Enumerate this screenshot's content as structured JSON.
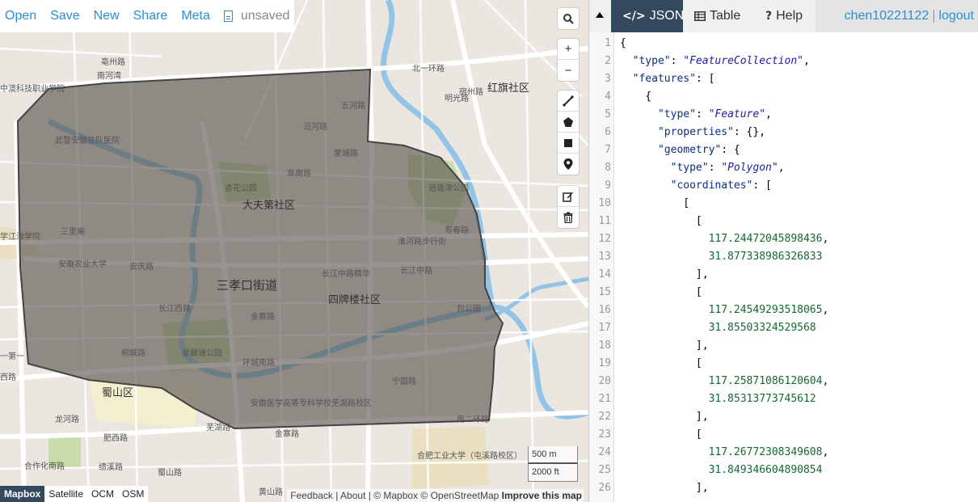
{
  "menu": {
    "open": "Open",
    "save": "Save",
    "new": "New",
    "share": "Share",
    "meta": "Meta",
    "file_status": "unsaved"
  },
  "map": {
    "labels": {
      "l1": "三孝口街道",
      "l2": "四牌楼社区",
      "l3": "大夫第社区",
      "l4": "红旗社区",
      "l5": "蜀山区",
      "l6": "安徽农业大学",
      "l7": "武警安徽总队医院",
      "l8": "中澳科技职业学院",
      "l9": "逍遥津公园",
      "l10": "包公园",
      "l11": "杏花公园",
      "l12": "皇藏塘公园",
      "l13": "合肥工业大学（屯溪路校区）",
      "l14": "安徽医学高等专科学校芜湖路校区",
      "l15": "长江中路",
      "l16": "长江西路",
      "l17": "环城南路",
      "l18": "芜湖路",
      "l19": "安庆路",
      "l20": "沿河路",
      "l21": "南河湾",
      "l22": "北一环路",
      "l23": "明光路",
      "l24": "蒙城路",
      "l25": "金寨路",
      "l26": "绩溪路",
      "l27": "龙河路",
      "l28": "黄山路",
      "l29": "宿州路",
      "l30": "淮河路步行街",
      "l31": "宁国路",
      "l32": "五河路",
      "l33": "寿春路",
      "l34": "阜南路",
      "l35": "亳州路",
      "l36": "长江中路精华",
      "l37": "三里庵",
      "l38": "学江淮学院",
      "l39": "一第一",
      "l40": "西路",
      "l41": "合作化南路",
      "l42": "肥西路",
      "l43": "南二环路",
      "l44": "桐城路",
      "l45": "金寨路",
      "l46": "蜀山路"
    }
  },
  "controls": {
    "search_icon": "search-icon",
    "zoom_in": "+",
    "zoom_out": "−"
  },
  "layers": [
    "Mapbox",
    "Satellite",
    "OCM",
    "OSM"
  ],
  "scale": {
    "metric": "500 m",
    "imperial": "2000 ft"
  },
  "attribution": {
    "feedback": "Feedback | About | © Mapbox © OpenStreetMap ",
    "improve": "Improve this map"
  },
  "pane": {
    "tabs": {
      "json": "JSON",
      "table": "Table",
      "help": "Help"
    },
    "user": "chen10221122",
    "sep": "|",
    "logout": "logout"
  },
  "editor": {
    "lines": [
      {
        "n": "1",
        "code": "{"
      },
      {
        "n": "2",
        "code": "  \"type\": \"FeatureCollection\","
      },
      {
        "n": "3",
        "code": "  \"features\": ["
      },
      {
        "n": "4",
        "code": "    {"
      },
      {
        "n": "5",
        "code": "      \"type\": \"Feature\","
      },
      {
        "n": "6",
        "code": "      \"properties\": {},"
      },
      {
        "n": "7",
        "code": "      \"geometry\": {"
      },
      {
        "n": "8",
        "code": "        \"type\": \"Polygon\","
      },
      {
        "n": "9",
        "code": "        \"coordinates\": ["
      },
      {
        "n": "10",
        "code": "          ["
      },
      {
        "n": "11",
        "code": "            ["
      },
      {
        "n": "12",
        "code": "              117.24472045898436,"
      },
      {
        "n": "13",
        "code": "              31.877338986326833"
      },
      {
        "n": "14",
        "code": "            ],"
      },
      {
        "n": "15",
        "code": "            ["
      },
      {
        "n": "16",
        "code": "              117.24549293518065,"
      },
      {
        "n": "17",
        "code": "              31.85503324529568"
      },
      {
        "n": "18",
        "code": "            ],"
      },
      {
        "n": "19",
        "code": "            ["
      },
      {
        "n": "20",
        "code": "              117.25871086120604,"
      },
      {
        "n": "21",
        "code": "              31.85313773745612"
      },
      {
        "n": "22",
        "code": "            ],"
      },
      {
        "n": "23",
        "code": "            ["
      },
      {
        "n": "24",
        "code": "              117.26772308349608,"
      },
      {
        "n": "25",
        "code": "              31.849346604890854"
      },
      {
        "n": "26",
        "code": "            ],"
      }
    ]
  }
}
